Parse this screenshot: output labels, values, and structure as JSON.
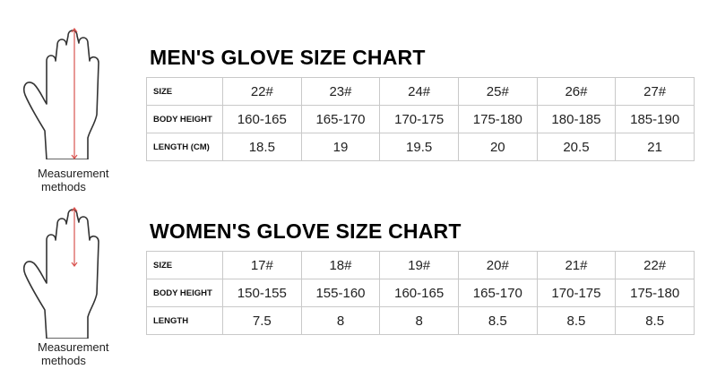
{
  "men": {
    "title": "MEN'S GLOVE SIZE CHART",
    "measurement_caption": [
      "Measurement",
      "methods"
    ],
    "rows": [
      {
        "label": "SIZE",
        "values": [
          "22#",
          "23#",
          "24#",
          "25#",
          "26#",
          "27#"
        ]
      },
      {
        "label": "BODY HEIGHT",
        "values": [
          "160-165",
          "165-170",
          "170-175",
          "175-180",
          "180-185",
          "185-190"
        ]
      },
      {
        "label": "LENGTH (CM)",
        "values": [
          "18.5",
          "19",
          "19.5",
          "20",
          "20.5",
          "21"
        ]
      }
    ]
  },
  "women": {
    "title": "WOMEN'S GLOVE SIZE CHART",
    "measurement_caption": [
      "Measurement",
      "methods"
    ],
    "rows": [
      {
        "label": "SIZE",
        "values": [
          "17#",
          "18#",
          "19#",
          "20#",
          "21#",
          "22#"
        ]
      },
      {
        "label": "BODY HEIGHT",
        "values": [
          "150-155",
          "155-160",
          "160-165",
          "165-170",
          "170-175",
          "175-180"
        ]
      },
      {
        "label": "LENGTH",
        "values": [
          "7.5",
          "8",
          "8",
          "8.5",
          "8.5",
          "8.5"
        ]
      }
    ]
  },
  "colors": {
    "measure_line": "#d9534f",
    "hand_outline": "#333333",
    "table_border": "#c9c9c9"
  },
  "icons": {
    "hand": "hand-outline-icon"
  }
}
